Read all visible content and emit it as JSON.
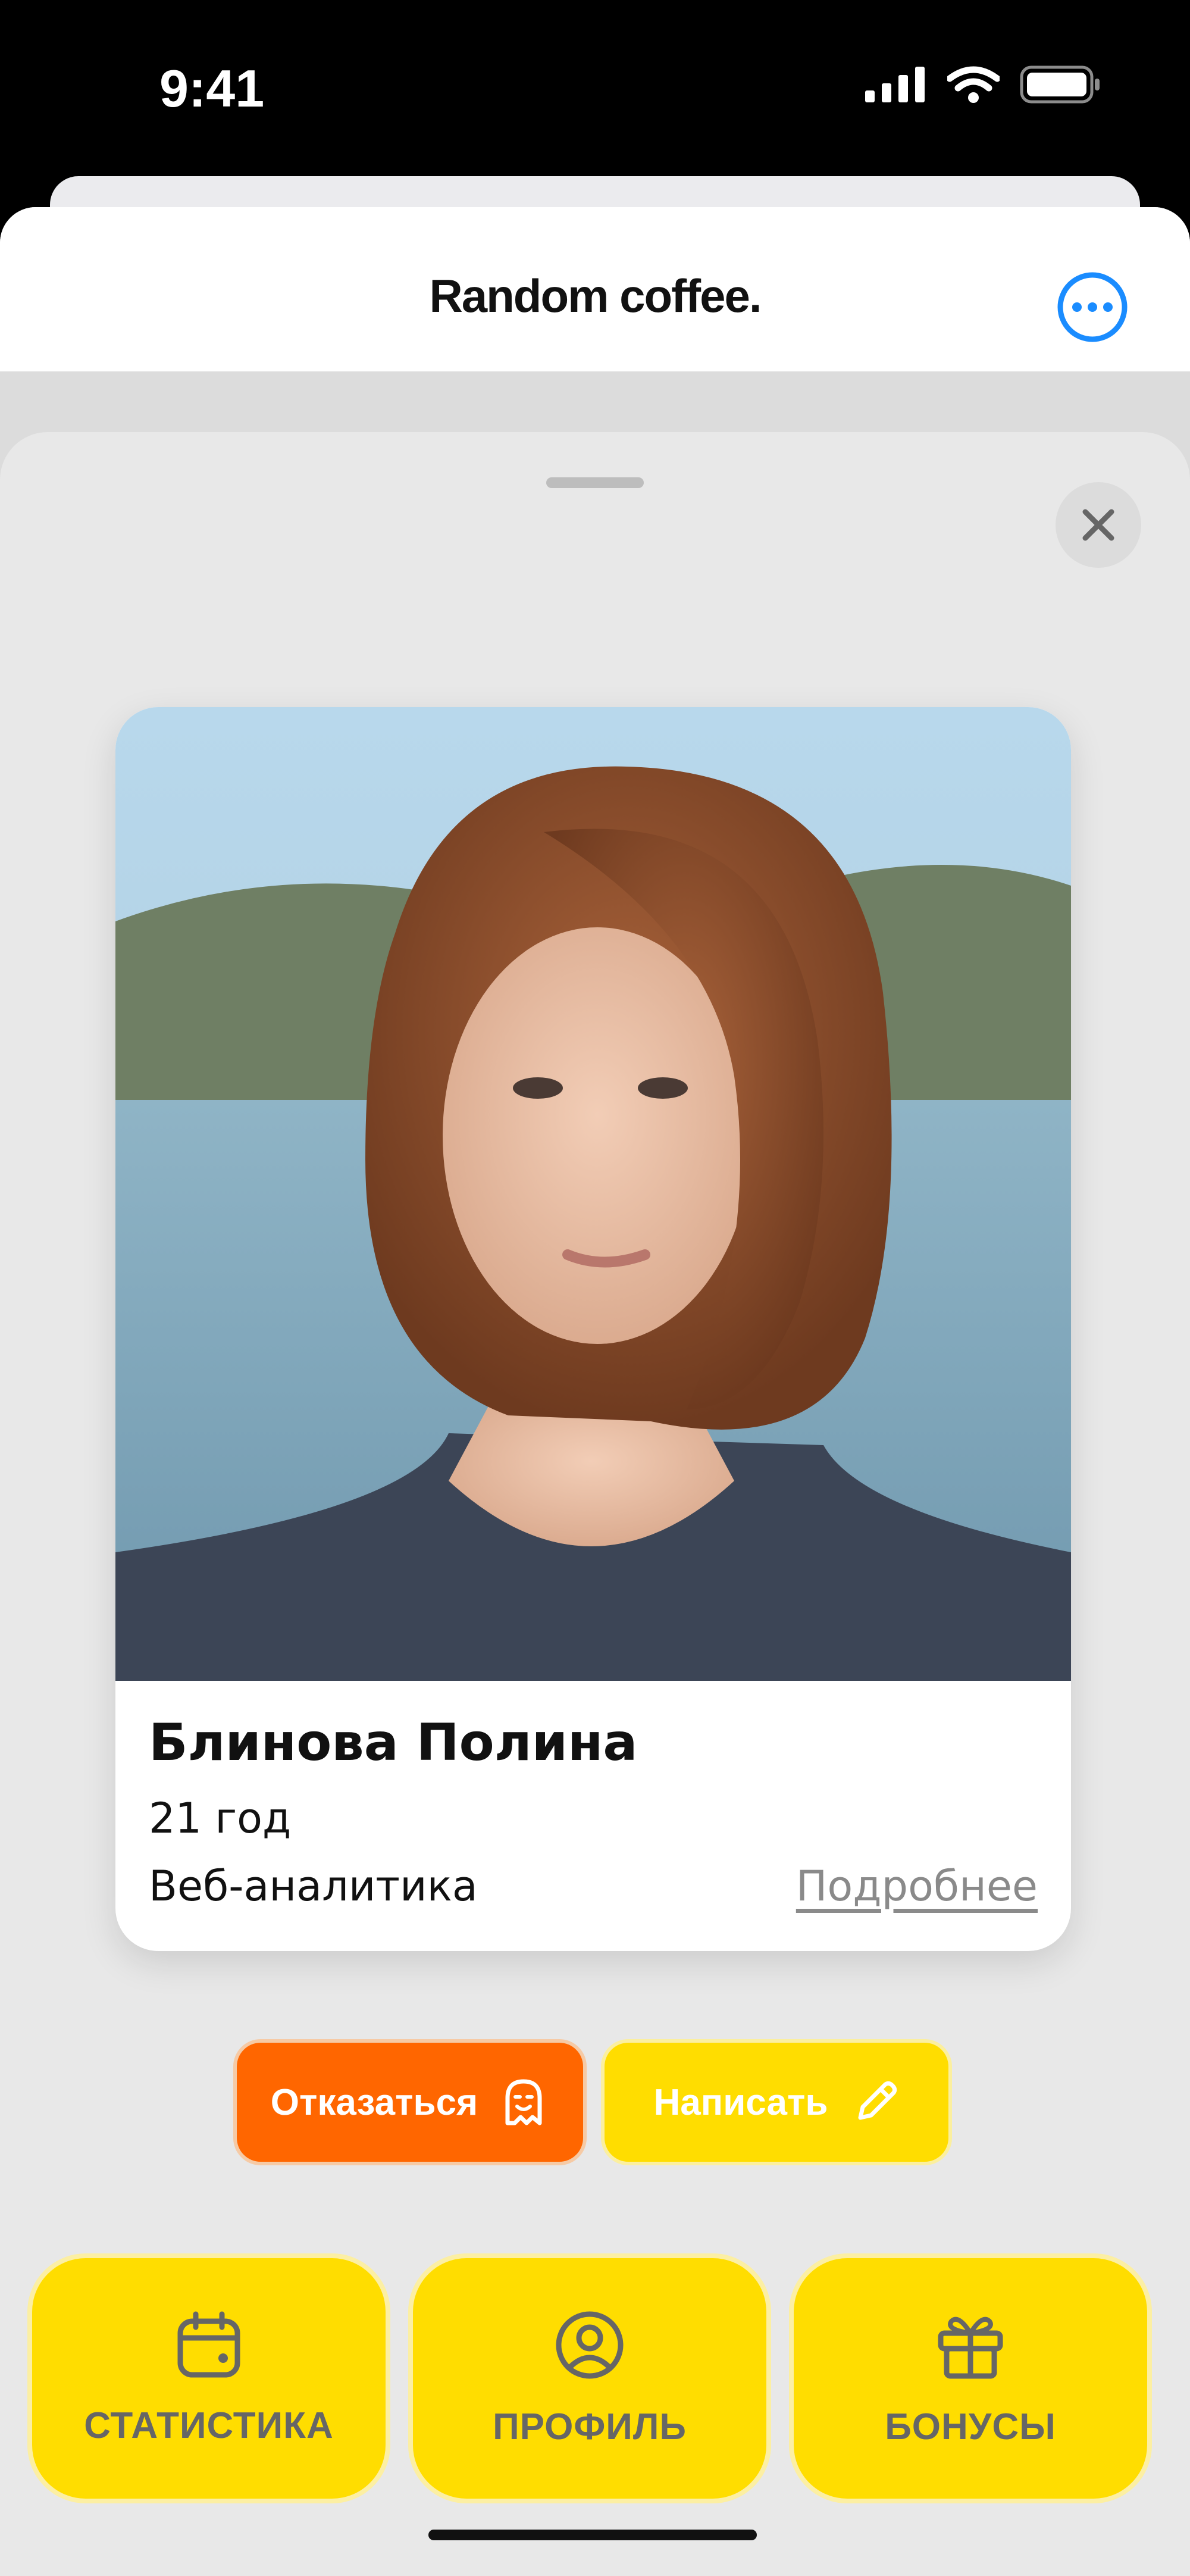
{
  "status_bar": {
    "time": "9:41",
    "icons": [
      "signal-icon",
      "wifi-icon",
      "battery-icon"
    ]
  },
  "nav": {
    "title": "Random coffee.",
    "more_icon": "ellipsis-circle-icon"
  },
  "modal": {
    "close_icon": "close-icon"
  },
  "profile": {
    "name": "Блинова Полина",
    "age": "21 год",
    "role": "Веб-аналитика",
    "details_link": "Подробнее",
    "photo_alt": "photo"
  },
  "actions": {
    "decline": {
      "label": "Отказаться",
      "icon": "ghost-face-icon",
      "color": "#ff6600"
    },
    "write": {
      "label": "Написать",
      "icon": "pencil-icon",
      "color": "#ffdd00"
    }
  },
  "tabs": [
    {
      "label": "СТАТИСТИКА",
      "icon": "calendar-icon"
    },
    {
      "label": "ПРОФИЛЬ",
      "icon": "user-circle-icon"
    },
    {
      "label": "БОНУСЫ",
      "icon": "gift-icon"
    }
  ],
  "colors": {
    "accent_yellow": "#ffdd00",
    "accent_orange": "#ff6600",
    "link_blue": "#1a8cff"
  }
}
